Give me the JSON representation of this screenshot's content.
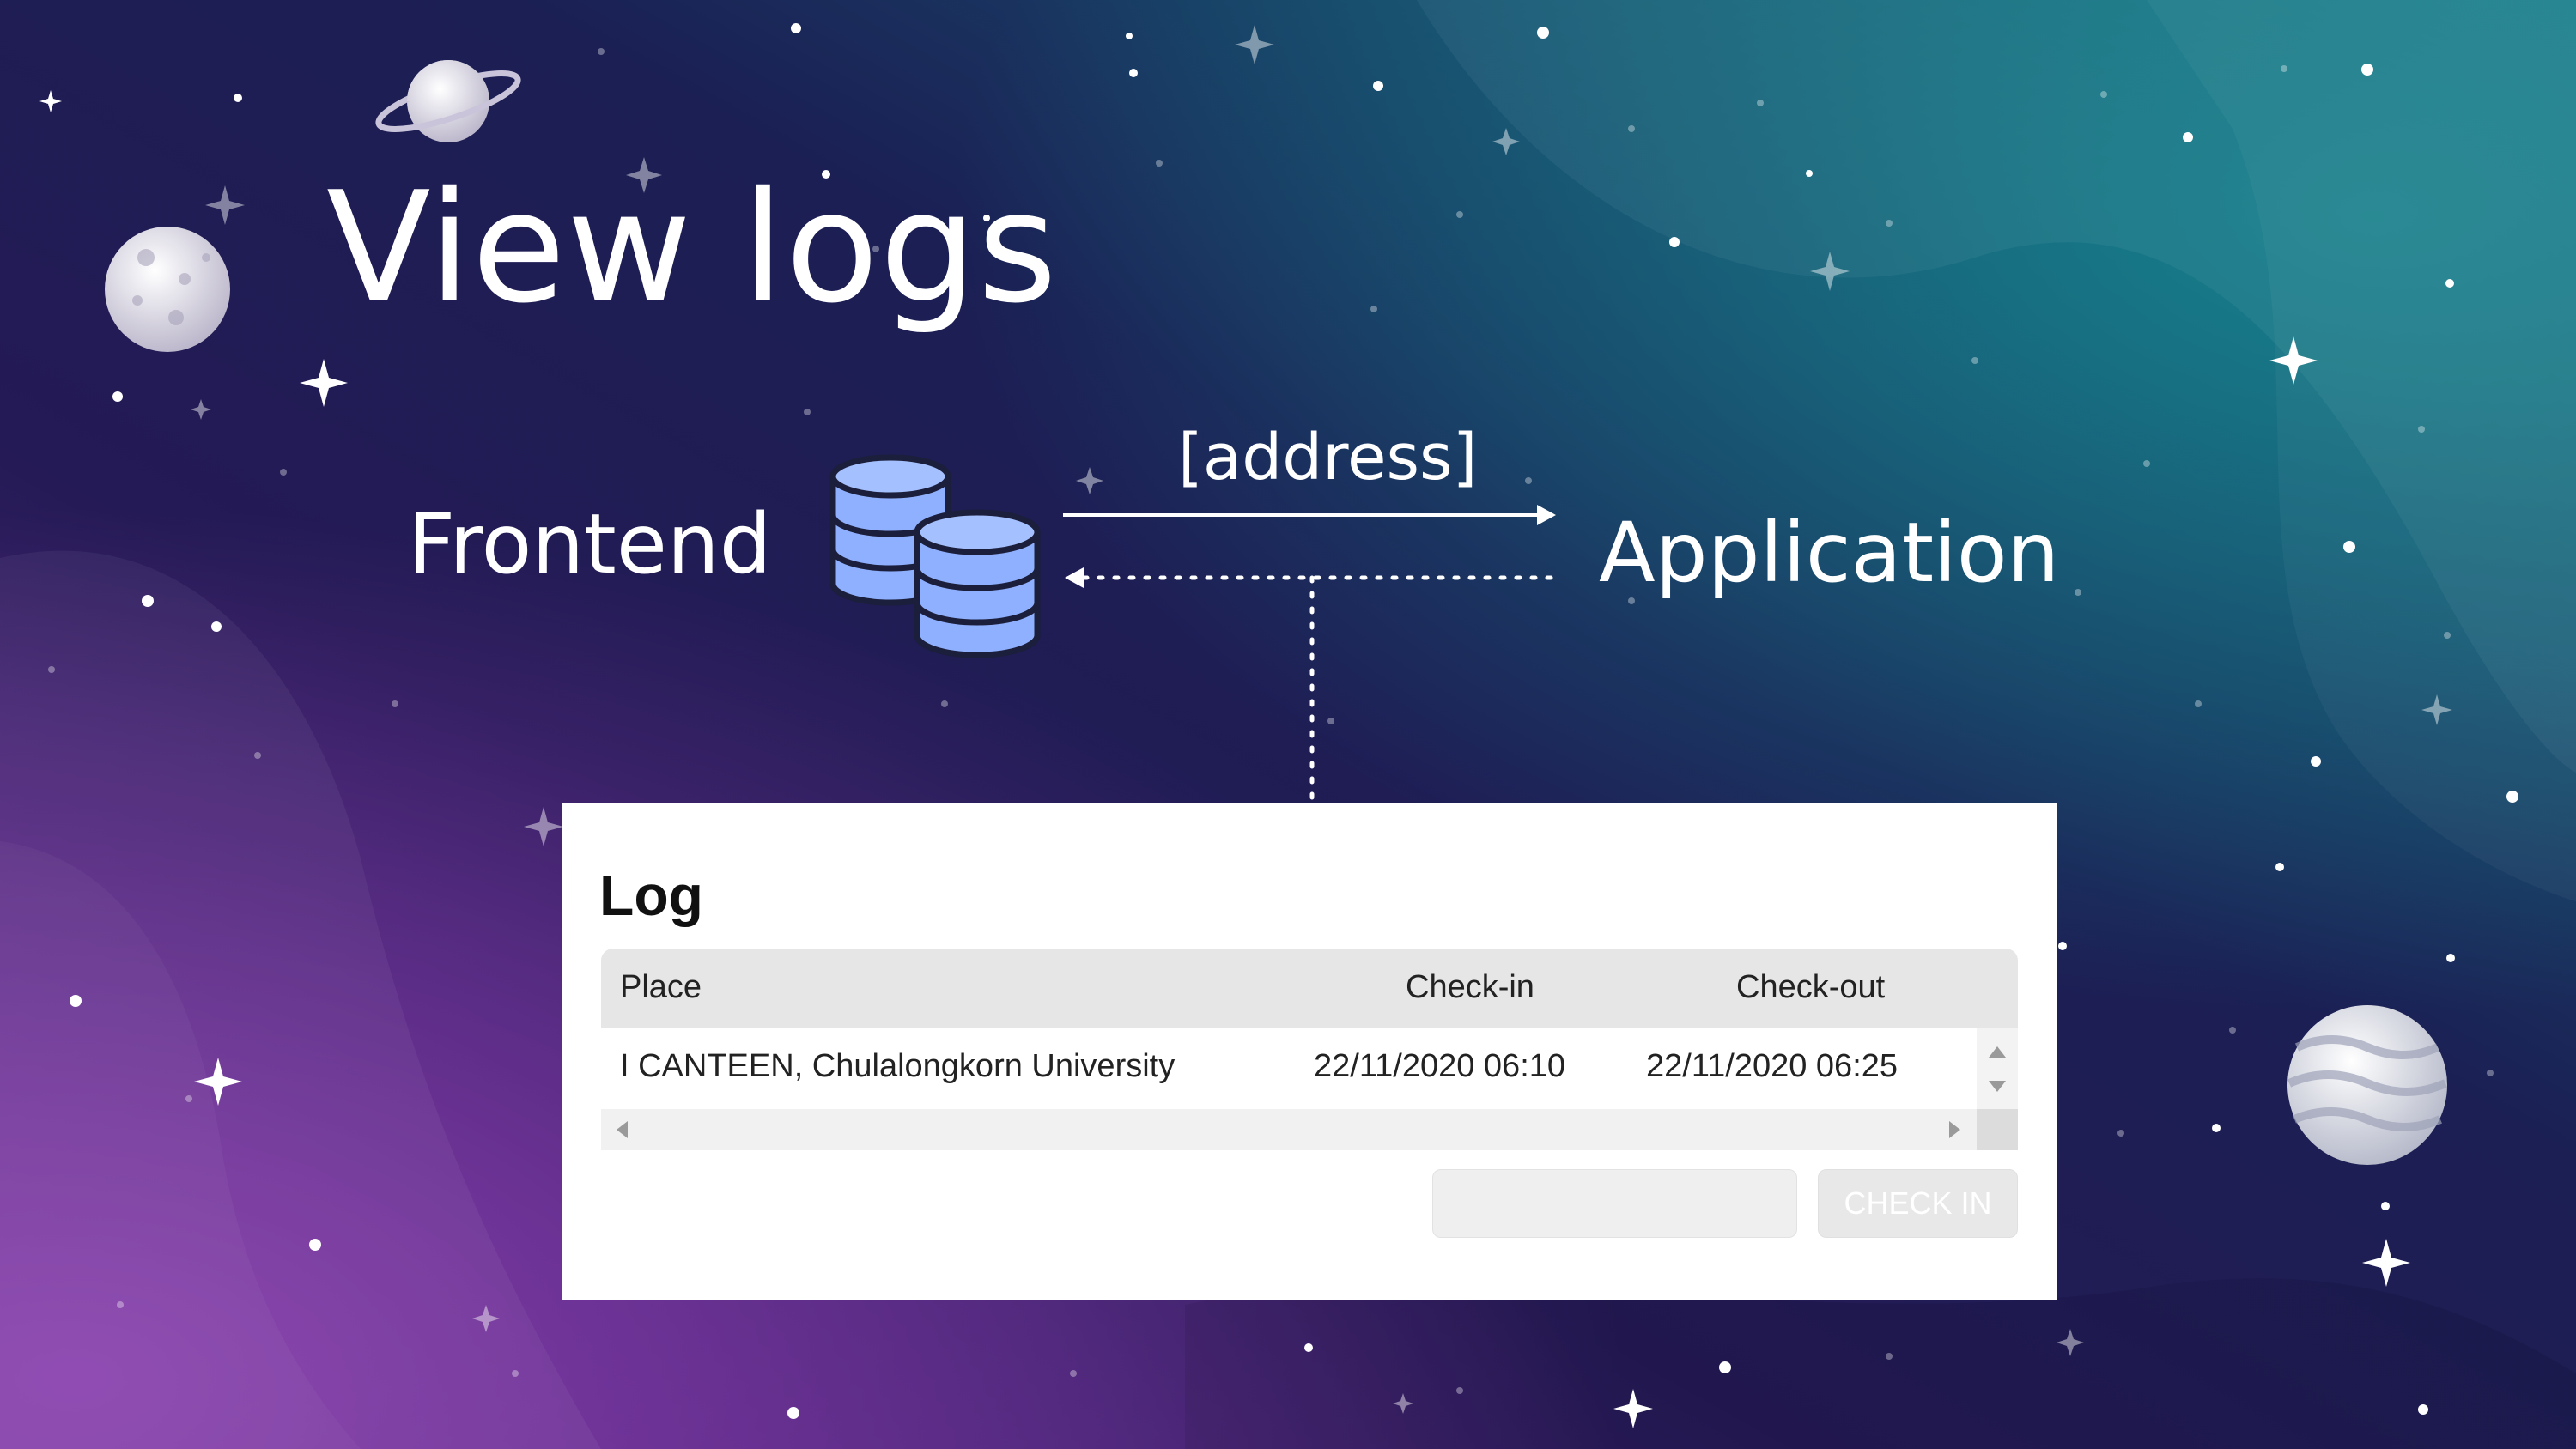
{
  "slide": {
    "title": "View logs"
  },
  "diagram": {
    "frontend_label": "Frontend",
    "application_label": "Application",
    "request_label": "[address]",
    "database_icon": "database-icon",
    "line_color": "#ffffff",
    "icon_color": "#8fb0ff"
  },
  "log_panel": {
    "title": "Log",
    "columns": [
      "Place",
      "Check-in",
      "Check-out"
    ],
    "rows": [
      {
        "place": "I CANTEEN, Chulalongkorn University",
        "check_in": "22/11/2020 06:10",
        "check_out": "22/11/2020 06:25"
      }
    ],
    "input_value": "",
    "button_label": "CHECK IN"
  },
  "background": {
    "colors": [
      "#2a1a56",
      "#1e1d52",
      "#1a2f5c",
      "#157885",
      "#7b3aa0"
    ]
  }
}
